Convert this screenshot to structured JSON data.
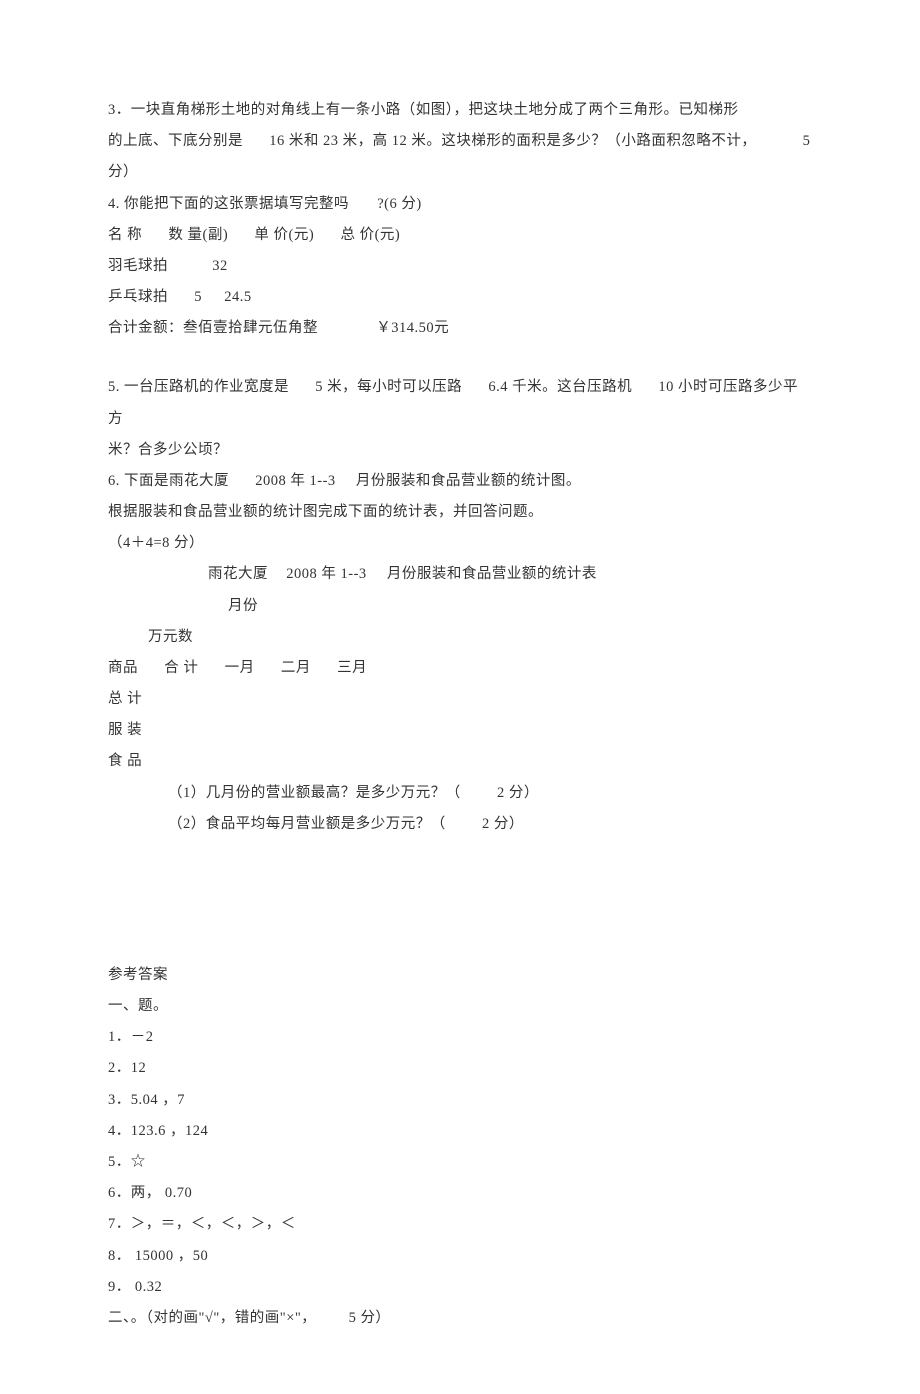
{
  "q3": {
    "text_part1": "3．一块直角梯形土地的对角线上有一条小路（如图），把这块土地分成了两个三角形。已知梯形",
    "text_part2_a": "的上底、下底分别是",
    "text_part2_b": "16 米和 23 米，高 12 米。这块梯形的面积是多少？（小路面积忽略不计，",
    "text_part2_c": "5",
    "text_part3": "分）"
  },
  "q4": {
    "line1_a": "4. 你能把下面的这张票据填写完整吗",
    "line1_b": "?(6 分)",
    "header": {
      "c1": "名 称",
      "c2": "数 量(副)",
      "c3": "单 价(元)",
      "c4": "总 价(元)"
    },
    "row1": {
      "name": "羽毛球拍",
      "qty": "32"
    },
    "row2": {
      "name": "乒乓球拍",
      "qty": "5",
      "price": "24.5"
    },
    "total_label": "合计金额：叁佰壹拾肆元伍角整",
    "total_amount": "￥314.50元"
  },
  "q5": {
    "part1_a": "5. 一台压路机的作业宽度是",
    "part1_b": "5 米，每小时可以压路",
    "part1_c": "6.4 千米。这台压路机",
    "part1_d": "10 小时可压路多少平方",
    "part2": "米？合多少公顷？"
  },
  "q6": {
    "line1_a": "6. 下面是雨花大厦",
    "line1_b": "2008 年 1--3",
    "line1_c": "月份服装和食品营业额的统计图。",
    "line2": "根据服装和食品营业额的统计图完成下面的统计表，并回答问题。",
    "line3": "（4＋4=8 分）",
    "table_title_a": "雨花大厦",
    "table_title_b": "2008 年 1--3",
    "table_title_c": "月份服装和食品营业额的统计表",
    "col_month": "月份",
    "col_amount": "万元数",
    "header": {
      "c1": "商品",
      "c2": "合 计",
      "c3": "一月",
      "c4": "二月",
      "c5": "三月"
    },
    "row_total": "总 计",
    "row_clothes": "服 装",
    "row_food": "食 品",
    "sub1_a": "（1）几月份的营业额最高？是多少万元？（",
    "sub1_b": "2 分）",
    "sub2_a": "（2）食品平均每月营业额是多少万元？（",
    "sub2_b": "2 分）"
  },
  "answers": {
    "title": "参考答案",
    "sect1": "一、题。",
    "a1": "1．－2",
    "a2": "2．12",
    "a3": "3．5.04 ，7",
    "a4": "4．123.6 ，124",
    "a5": "5．☆",
    "a6": "6．两， 0.70",
    "a7": "7．＞，＝，＜，＜，＞，＜",
    "a8": "8．  15000 ，50",
    "a9": "9．  0.32",
    "sect2_a": "二、。（对的画\"√\"，错的画\"×\"，",
    "sect2_b": "5 分）"
  }
}
